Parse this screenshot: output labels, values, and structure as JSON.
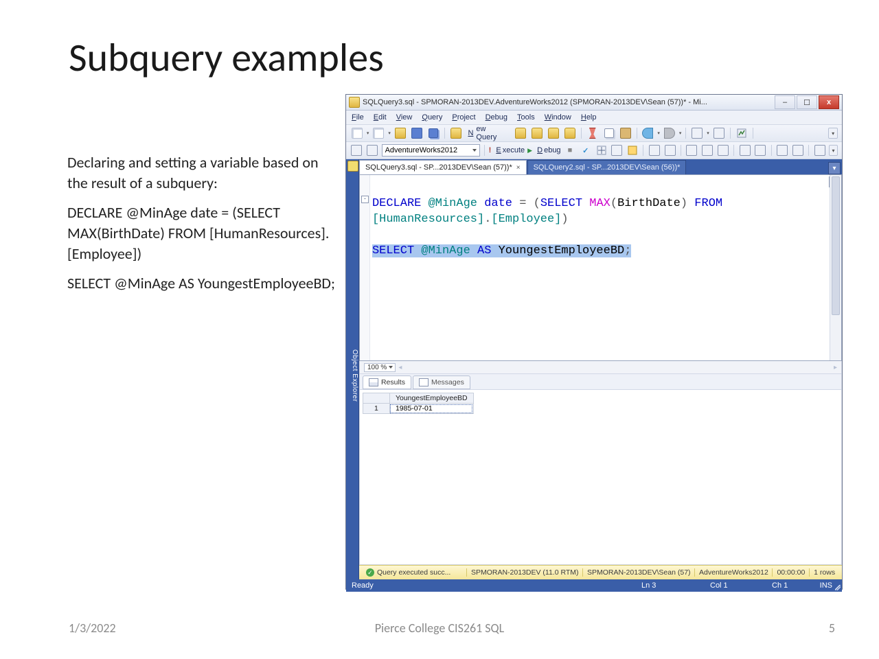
{
  "slide": {
    "title": "Subquery examples",
    "p1": "Declaring and setting a variable based on the result of a subquery:",
    "p2": "DECLARE @MinAge date = (SELECT MAX(BirthDate) FROM [HumanResources].[Employee])",
    "p3": "SELECT @MinAge AS YoungestEmployeeBD;"
  },
  "footer": {
    "date": "1/3/2022",
    "center": "Pierce College CIS261 SQL",
    "page": "5"
  },
  "ssms": {
    "window_title": "SQLQuery3.sql - SPMORAN-2013DEV.AdventureWorks2012 (SPMORAN-2013DEV\\Sean (57))* - Mi...",
    "menus": {
      "file": "File",
      "edit": "Edit",
      "view": "View",
      "query": "Query",
      "project": "Project",
      "debug": "Debug",
      "tools": "Tools",
      "window": "Window",
      "help": "Help"
    },
    "toolbar": {
      "new_query": "New Query",
      "db": "AdventureWorks2012",
      "execute": "Execute",
      "debug": "Debug"
    },
    "sidebar_label": "Object Explorer",
    "tabs": {
      "active": "SQLQuery3.sql - SP...2013DEV\\Sean (57))*",
      "inactive": "SQLQuery2.sql - SP...2013DEV\\Sean (56))*"
    },
    "zoom": "100 %",
    "result_tabs": {
      "results": "Results",
      "messages": "Messages"
    },
    "grid": {
      "col1": "YoungestEmployeeBD",
      "row1_num": "1",
      "row1_val": "1985-07-01"
    },
    "status": {
      "exec": "Query executed succ...",
      "server_ver": "SPMORAN-2013DEV (11.0 RTM)",
      "login": "SPMORAN-2013DEV\\Sean (57)",
      "db": "AdventureWorks2012",
      "elapsed": "00:00:00",
      "rows": "1 rows"
    },
    "bottom": {
      "ready": "Ready",
      "ln": "Ln 3",
      "col": "Col 1",
      "ch": "Ch 1",
      "ins": "INS"
    },
    "sql": {
      "declare": "DECLARE",
      "var": "@MinAge",
      "datetype": "date",
      "eq": " = ",
      "lp": "(",
      "select": "SELECT",
      "sp": " ",
      "max": "MAX",
      "lp2": "(",
      "birthdate": "BirthDate",
      "rp2": ")",
      "from": "FROM",
      "hr_open": "[HumanResources]",
      "dot": ".",
      "emp": "[Employee]",
      "rp": ")",
      "as": "AS",
      "alias": "YoungestEmployeeBD",
      "semi": ";"
    }
  }
}
